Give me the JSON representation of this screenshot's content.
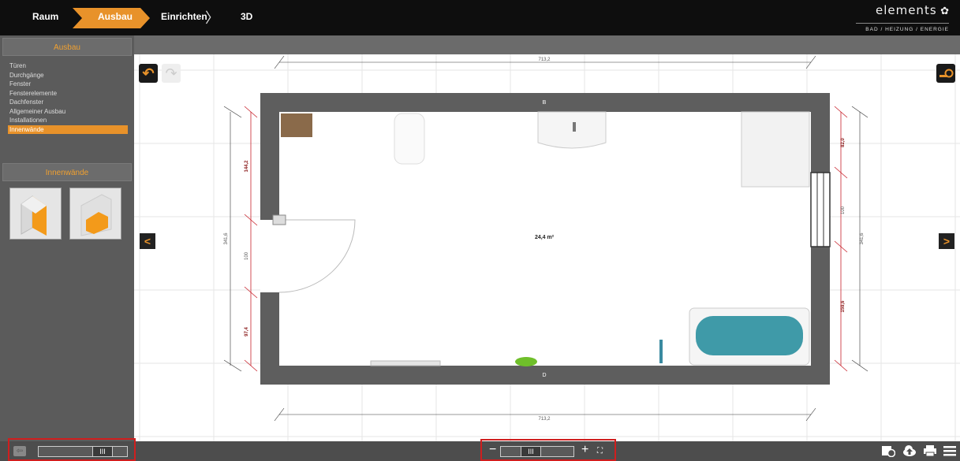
{
  "topbar": {
    "steps": [
      "Raum",
      "Ausbau",
      "Einrichten",
      "3D"
    ],
    "brand_name": "elements",
    "brand_tagline": "BAD / HEIZUNG / ENERGIE"
  },
  "sidebar": {
    "section_title": "Ausbau",
    "items": [
      {
        "label": "Türen"
      },
      {
        "label": "Durchgänge"
      },
      {
        "label": "Fenster"
      },
      {
        "label": "Fensterelemente"
      },
      {
        "label": "Dachfenster"
      },
      {
        "label": "Allgemeiner Ausbau"
      },
      {
        "label": "Installationen"
      },
      {
        "label": "Innenwände",
        "active": true
      }
    ],
    "subsection_title": "Innenwände"
  },
  "plan": {
    "wall_top_label": "B",
    "wall_bottom_label": "D",
    "area_label": "24,4 m²",
    "dim_top": "713,2",
    "dim_bottom": "713,2",
    "dim_left_total": "341,6",
    "dim_right_total": "341,6",
    "dim_left_segments": [
      "144,2",
      "100",
      "97,4"
    ],
    "dim_right_segments": [
      "82,0",
      "100",
      "159,6"
    ]
  },
  "bottombar": {
    "left_slider_thumb": "III",
    "zoom_thumb": "III",
    "zoom_minus": "−",
    "zoom_plus": "+"
  },
  "colors": {
    "accent": "#e8922a",
    "wall": "#5e5e5e",
    "dimension_red": "#c8202a",
    "highlight_box": "#d01e1e"
  },
  "icons": [
    "undo-icon",
    "redo-icon",
    "measure-icon",
    "chevron-left-icon",
    "chevron-right-icon",
    "exit-icon",
    "fullscreen-icon",
    "history-icon",
    "upload-icon",
    "print-icon",
    "menu-icon"
  ]
}
